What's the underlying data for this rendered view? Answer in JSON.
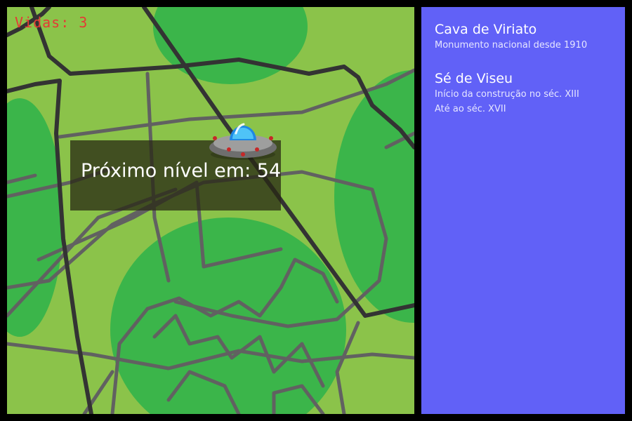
{
  "hud": {
    "lives_text": "Vidas: 3"
  },
  "overlay": {
    "level_text": "Próximo nível em: 54"
  },
  "sidebar": {
    "places": [
      {
        "title": "Cava de Viriato",
        "lines": [
          "Monumento nacional desde 1910"
        ]
      },
      {
        "title": "Sé de Viseu",
        "lines": [
          "Início da construção no séc. XIII",
          "Até ao séc. XVII"
        ]
      }
    ]
  },
  "colors": {
    "map_light_green": "#8bc34a",
    "map_dark_green": "#3bb54a",
    "major_road": "#333333",
    "minor_road": "#616161",
    "lives_red": "#e53935",
    "sidebar_blue": "#6161f7"
  },
  "icons": {
    "player": "ufo-icon"
  }
}
